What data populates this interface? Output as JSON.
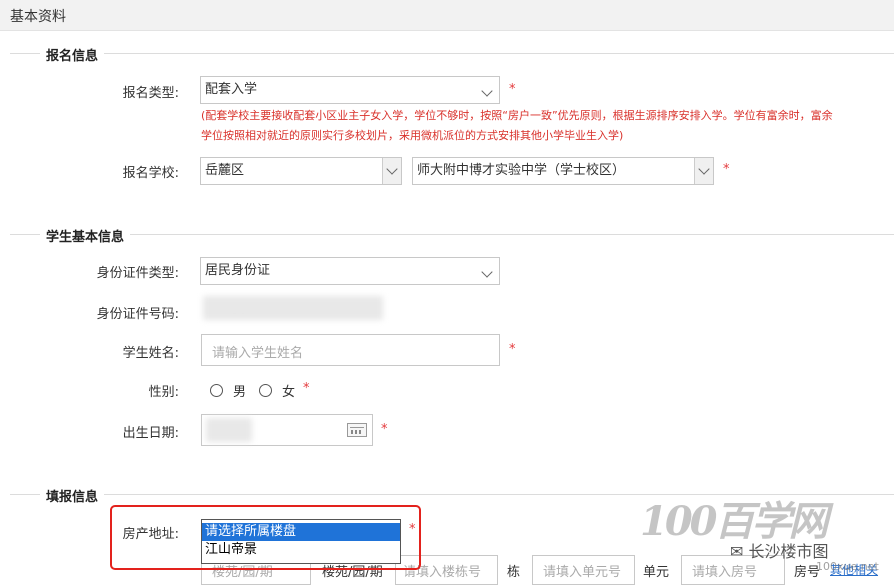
{
  "page": {
    "title": "基本资料"
  },
  "sections": {
    "registration": "报名信息",
    "student": "学生基本信息",
    "report": "填报信息"
  },
  "registration": {
    "type_label": "报名类型:",
    "type_value": "配套入学",
    "note": "(配套学校主要接收配套小区业主子女入学，学位不够时，按照“房户一致”优先原则，根据生源排序安排入学。学位有富余时，富余学位按照相对就近的原则实行多校划片，采用微机派位的方式安排其他小学毕业生入学)",
    "school_label": "报名学校:",
    "district_value": "岳麓区",
    "school_value": "师大附中博才实验中学（学士校区）"
  },
  "student": {
    "id_type_label": "身份证件类型:",
    "id_type_value": "居民身份证",
    "id_number_label": "身份证件号码:",
    "id_number_partial": "430",
    "name_label": "学生姓名:",
    "name_placeholder": "请输入学生姓名",
    "gender_label": "性别:",
    "gender_male": "男",
    "gender_female": "女",
    "birth_label": "出生日期:"
  },
  "report": {
    "property_label": "房产地址:",
    "dropdown_options": [
      "请选择所属楼盘",
      "江山帝景"
    ],
    "building_placeholder": "楼苑/园/期",
    "building_unit": "楼苑/园/期",
    "dong_placeholder": "请填入楼栋号",
    "dong_unit": "栋",
    "unit_placeholder": "请填入单元号",
    "unit_unit": "单元",
    "room_placeholder": "请填入房号",
    "room_unit": "房号",
    "other_link": "其他相关"
  },
  "required_mark": "*",
  "watermark": {
    "logo_text": "100百学网",
    "wechat_text": "长沙楼市图",
    "site_text": "100xue.net"
  },
  "colors": {
    "required": "#e4393c",
    "note": "#d9312b",
    "selected_option": "#1f73d8",
    "highlight_box": "#e3221d"
  }
}
